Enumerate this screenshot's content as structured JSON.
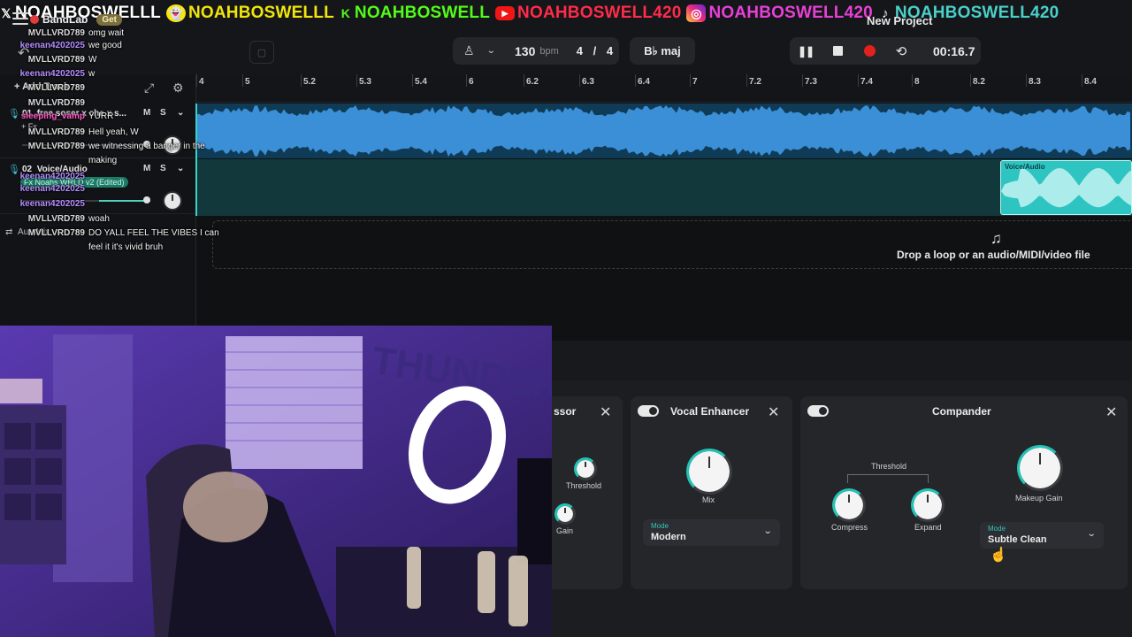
{
  "socials": [
    {
      "icon": "x-icon",
      "glyph": "𝕏",
      "handle": "NOAHBOSWELLL"
    },
    {
      "icon": "snapchat-icon",
      "glyph": "👻",
      "handle": "NOAHBOSWELLL"
    },
    {
      "icon": "kick-icon",
      "glyph": "K",
      "handle": "NOAHBOSWELL"
    },
    {
      "icon": "youtube-icon",
      "glyph": "▶",
      "handle": "NOAHBOSWELL420"
    },
    {
      "icon": "instagram-icon",
      "glyph": "◎",
      "handle": "NOAHBOSWELL420"
    },
    {
      "icon": "tiktok-icon",
      "glyph": "♪",
      "handle": "NOAHBOSWELL420"
    }
  ],
  "app": {
    "logo": "BandLab",
    "get_label": "Get",
    "project_title": "New Project"
  },
  "toolbar": {
    "tempo": "130",
    "tempo_unit": "bpm",
    "time_signature": "4 / 4",
    "key": "B♭ maj",
    "time": "00:16.7",
    "pause_glyph": "❚❚",
    "loop_glyph": "⟲",
    "metronome_glyph": "♙",
    "chevron_glyph": "⌄",
    "undo_glyph": "↶"
  },
  "ruler": {
    "ticks": [
      "4",
      "5",
      "5.2",
      "5.3",
      "5.4",
      "6",
      "6.2",
      "6.3",
      "6.4",
      "7",
      "7.2",
      "7.3",
      "7.4",
      "8",
      "8.2",
      "8.3",
      "8.4"
    ]
  },
  "tracks_panel": {
    "add_track": "+ Add Track",
    "tracks": [
      {
        "number": "01",
        "name": "free soser x che x s...",
        "mute": "M",
        "solo": "S",
        "fx": "+ Fx"
      },
      {
        "number": "02",
        "name": "Voice/Audio",
        "mute": "M",
        "solo": "S",
        "fx": "Fx Noahs WRLD v2 (Edited)"
      }
    ],
    "automix": "AutoMix"
  },
  "chat": [
    {
      "user": "MVLLVRD789",
      "msg": "omg wait",
      "cls": "c-mvl"
    },
    {
      "user": "keenan4202025",
      "msg": "we good",
      "cls": "c-kee"
    },
    {
      "user": "MVLLVRD789",
      "msg": "W",
      "cls": "c-mvl"
    },
    {
      "user": "keenan4202025",
      "msg": "w",
      "cls": "c-kee"
    },
    {
      "user": "MVLLVRD789",
      "msg": "",
      "cls": "c-mvl"
    },
    {
      "user": "MVLLVRD789",
      "msg": "",
      "cls": "c-mvl"
    },
    {
      "user": "sleeping_vamp",
      "msg": "YURR",
      "cls": "c-pink"
    },
    {
      "user": "MVLLVRD789",
      "msg": "Hell yeah, W",
      "cls": "c-mvl"
    },
    {
      "user": "MVLLVRD789",
      "msg": "we witnessing a banger in the making",
      "cls": "c-mvl"
    },
    {
      "user": "keenan4202025",
      "msg": "",
      "cls": "c-kee"
    },
    {
      "user": "keenan4202025",
      "msg": "",
      "cls": "c-kee"
    },
    {
      "user": "keenan4202025",
      "msg": "",
      "cls": "c-kee"
    },
    {
      "user": "MVLLVRD789",
      "msg": "woah",
      "cls": "c-mvl"
    },
    {
      "user": "MVLLVRD789",
      "msg": "DO YALL FEEL THE VIBES I can feel it it's vivid bruh",
      "cls": "c-mvl"
    }
  ],
  "timeline": {
    "clip_label": "Voice/Audio",
    "drop_text": "Drop a loop or an audio/MIDI/video file",
    "drop_glyph": "♫"
  },
  "fx": {
    "partial_title": "ssor",
    "partial_knobs": [
      "Threshold",
      "Gain"
    ],
    "close_glyph": "✕",
    "vocal_enhancer": {
      "title": "Vocal Enhancer",
      "knob": "Mix",
      "mode_label": "Mode",
      "mode_value": "Modern"
    },
    "compander": {
      "title": "Compander",
      "group_label": "Threshold",
      "knobs": [
        "Compress",
        "Expand",
        "Makeup Gain"
      ],
      "mode_label": "Mode",
      "mode_value": "Subtle Clean"
    }
  },
  "colors": {
    "accent": "#22c3b5",
    "track1_wave": "#3b8fd6",
    "track2_clip": "#2ec4c2",
    "record": "#e2201c"
  }
}
